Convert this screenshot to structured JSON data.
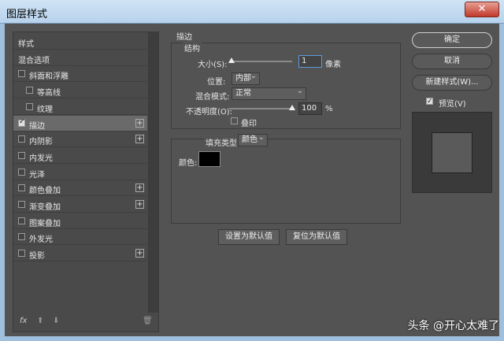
{
  "window": {
    "title": "图层样式",
    "close": "✕"
  },
  "styles_list": {
    "items": [
      {
        "label": "样式",
        "checkbox": false,
        "plus": false,
        "indent": 0,
        "active": false
      },
      {
        "label": "混合选项",
        "checkbox": false,
        "plus": false,
        "indent": 0,
        "active": false
      },
      {
        "label": "斜面和浮雕",
        "checkbox": true,
        "checked": false,
        "plus": false,
        "indent": 0,
        "active": false
      },
      {
        "label": "等高线",
        "checkbox": true,
        "checked": false,
        "plus": false,
        "indent": 1,
        "active": false
      },
      {
        "label": "纹理",
        "checkbox": true,
        "checked": false,
        "plus": false,
        "indent": 1,
        "active": false
      },
      {
        "label": "描边",
        "checkbox": true,
        "checked": true,
        "plus": true,
        "indent": 0,
        "active": true
      },
      {
        "label": "内阴影",
        "checkbox": true,
        "checked": false,
        "plus": true,
        "indent": 0,
        "active": false
      },
      {
        "label": "内发光",
        "checkbox": true,
        "checked": false,
        "plus": false,
        "indent": 0,
        "active": false
      },
      {
        "label": "光泽",
        "checkbox": true,
        "checked": false,
        "plus": false,
        "indent": 0,
        "active": false
      },
      {
        "label": "颜色叠加",
        "checkbox": true,
        "checked": false,
        "plus": true,
        "indent": 0,
        "active": false
      },
      {
        "label": "渐变叠加",
        "checkbox": true,
        "checked": false,
        "plus": true,
        "indent": 0,
        "active": false
      },
      {
        "label": "图案叠加",
        "checkbox": true,
        "checked": false,
        "plus": false,
        "indent": 0,
        "active": false
      },
      {
        "label": "外发光",
        "checkbox": true,
        "checked": false,
        "plus": false,
        "indent": 0,
        "active": false
      },
      {
        "label": "投影",
        "checkbox": true,
        "checked": false,
        "plus": true,
        "indent": 0,
        "active": false
      }
    ],
    "bottom_fx": "fx",
    "bottom_up": "⬆",
    "bottom_down": "⬇",
    "bottom_trash": "🗑"
  },
  "stroke": {
    "heading": "描边",
    "structure_heading": "结构",
    "size_label": "大小(S):",
    "size_value": "1",
    "size_unit": "像素",
    "position_label": "位置:",
    "position_value": "内部",
    "blend_label": "混合模式:",
    "blend_value": "正常",
    "opacity_label": "不透明度(O):",
    "opacity_value": "100",
    "opacity_unit": "%",
    "overprint_label": "叠印",
    "fill_type_label": "填充类型:",
    "fill_type_value": "颜色",
    "color_label": "颜色:",
    "color_hex": "#000000",
    "reset_default": "设置为默认值",
    "restore_default": "复位为默认值"
  },
  "right_panel": {
    "ok": "确定",
    "cancel": "取消",
    "new_style": "新建样式(W)...",
    "preview_label": "预览(V)",
    "preview_checked": true
  },
  "watermark": "头条 @开心太难了"
}
